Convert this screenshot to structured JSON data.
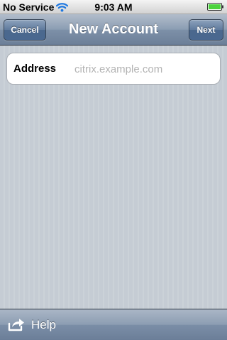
{
  "status_bar": {
    "carrier": "No Service",
    "time": "9:03 AM",
    "icons": [
      "wifi-icon",
      "battery-icon"
    ]
  },
  "nav_bar": {
    "title": "New Account",
    "left_button": "Cancel",
    "right_button": "Next"
  },
  "form": {
    "address_label": "Address",
    "address_value": "",
    "address_placeholder": "citrix.example.com"
  },
  "toolbar": {
    "icon": "share-icon",
    "help_label": "Help"
  },
  "colors": {
    "nav_bar": "#8b9db3",
    "background": "#c5ccd4",
    "placeholder": "#b3b3b3"
  }
}
